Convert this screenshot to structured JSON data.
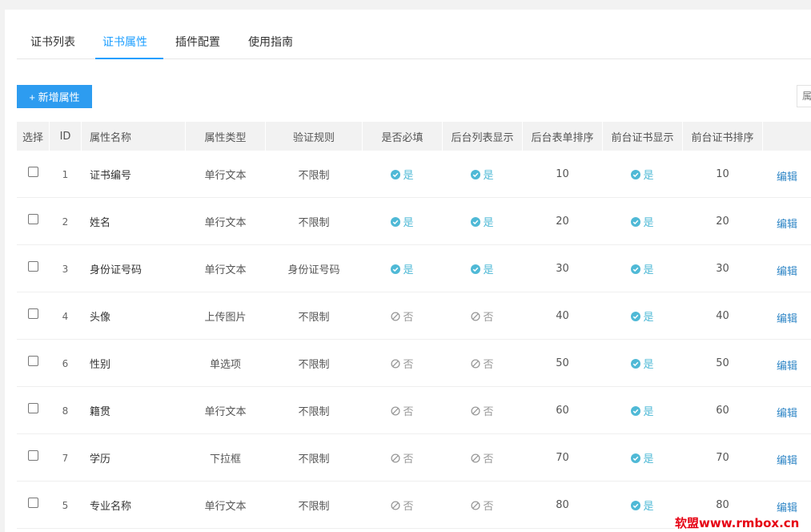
{
  "tabs": [
    "证书列表",
    "证书属性",
    "插件配置",
    "使用指南"
  ],
  "active_tab": 1,
  "add_button": "+ 新增属性",
  "search_placeholder": "属",
  "headers": [
    "选择",
    "ID",
    "属性名称",
    "属性类型",
    "验证规则",
    "是否必填",
    "后台列表显示",
    "后台表单排序",
    "前台证书显示",
    "前台证书排序",
    ""
  ],
  "rows": [
    {
      "id": "1",
      "name": "证书编号",
      "type": "单行文本",
      "rule": "不限制",
      "required": "是",
      "admin_list": "是",
      "admin_sort": "10",
      "front_show": "是",
      "front_sort": "10",
      "action": "编辑"
    },
    {
      "id": "2",
      "name": "姓名",
      "type": "单行文本",
      "rule": "不限制",
      "required": "是",
      "admin_list": "是",
      "admin_sort": "20",
      "front_show": "是",
      "front_sort": "20",
      "action": "编辑"
    },
    {
      "id": "3",
      "name": "身份证号码",
      "type": "单行文本",
      "rule": "身份证号码",
      "required": "是",
      "admin_list": "是",
      "admin_sort": "30",
      "front_show": "是",
      "front_sort": "30",
      "action": "编辑"
    },
    {
      "id": "4",
      "name": "头像",
      "type": "上传图片",
      "rule": "不限制",
      "required": "否",
      "admin_list": "否",
      "admin_sort": "40",
      "front_show": "是",
      "front_sort": "40",
      "action": "编辑"
    },
    {
      "id": "6",
      "name": "性别",
      "type": "单选项",
      "rule": "不限制",
      "required": "否",
      "admin_list": "否",
      "admin_sort": "50",
      "front_show": "是",
      "front_sort": "50",
      "action": "编辑"
    },
    {
      "id": "8",
      "name": "籍贯",
      "type": "单行文本",
      "rule": "不限制",
      "required": "否",
      "admin_list": "否",
      "admin_sort": "60",
      "front_show": "是",
      "front_sort": "60",
      "action": "编辑"
    },
    {
      "id": "7",
      "name": "学历",
      "type": "下拉框",
      "rule": "不限制",
      "required": "否",
      "admin_list": "否",
      "admin_sort": "70",
      "front_show": "是",
      "front_sort": "70",
      "action": "编辑"
    },
    {
      "id": "5",
      "name": "专业名称",
      "type": "单行文本",
      "rule": "不限制",
      "required": "否",
      "admin_list": "否",
      "admin_sort": "80",
      "front_show": "是",
      "front_sort": "80",
      "action": "编辑"
    }
  ],
  "watermark": {
    "part1": "软盟",
    "part2": "www.rmbox.cn"
  },
  "colors": {
    "accent": "#1e9fff",
    "button": "#2d9cf0",
    "yes": "#4fb9d6",
    "no": "#999999",
    "link": "#2f86c6"
  }
}
